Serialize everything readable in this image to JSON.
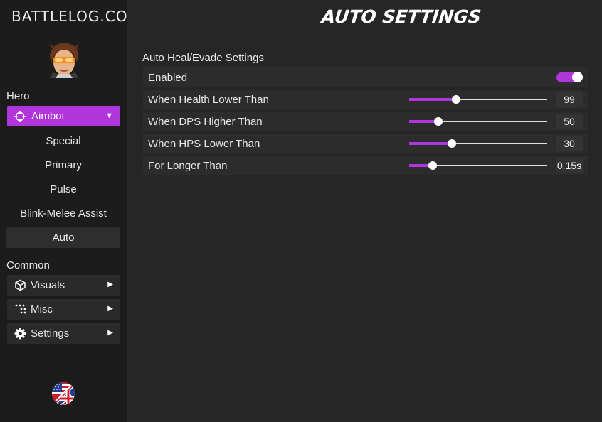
{
  "brand": "BATTLELOG.CO",
  "avatar": "tracer-avatar",
  "colors": {
    "accent": "#b035db",
    "sidebar_bg": "#1c1c1c",
    "main_bg": "#262626"
  },
  "sidebar": {
    "hero_label": "Hero",
    "aimbot": {
      "label": "Aimbot",
      "icon": "crosshair-icon"
    },
    "sub_items": [
      {
        "label": "Special",
        "active": false
      },
      {
        "label": "Primary",
        "active": false
      },
      {
        "label": "Pulse",
        "active": false
      },
      {
        "label": "Blink-Melee Assist",
        "active": false
      },
      {
        "label": "Auto",
        "active": true
      }
    ],
    "common_label": "Common",
    "categories": [
      {
        "label": "Visuals",
        "icon": "cube-icon"
      },
      {
        "label": "Misc",
        "icon": "dots-grid-icon"
      },
      {
        "label": "Settings",
        "icon": "gear-icon"
      }
    ],
    "language_icon": "uk-us-flag-icon"
  },
  "main": {
    "title": "AUTO SETTINGS",
    "group_title": "Auto Heal/Evade Settings",
    "enabled_label": "Enabled",
    "enabled": true,
    "sliders": [
      {
        "label": "When Health Lower Than",
        "value": "99",
        "fraction": 0.34
      },
      {
        "label": "When DPS Higher Than",
        "value": "50",
        "fraction": 0.21
      },
      {
        "label": "When HPS Lower Than",
        "value": "30",
        "fraction": 0.31
      },
      {
        "label": "For Longer Than",
        "value": "0.15s",
        "fraction": 0.17
      }
    ]
  }
}
